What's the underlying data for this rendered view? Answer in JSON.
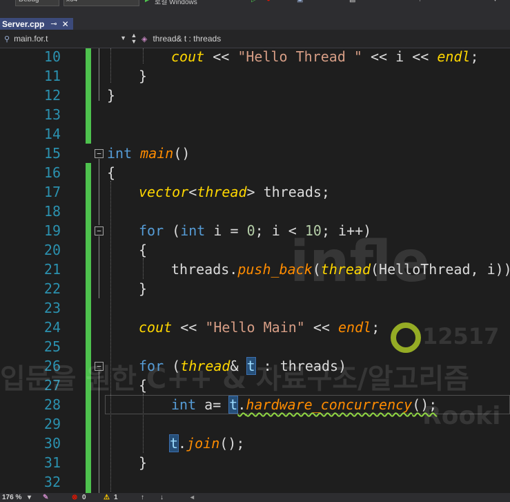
{
  "toolbar": {
    "config": "Debug",
    "platform": "x64",
    "run_label": "로컬 Windows"
  },
  "tab": {
    "filename": "Server.cpp",
    "pin_icon": "pin-icon",
    "close_icon": "close-icon"
  },
  "navbar": {
    "scope": "main.for.t",
    "member": "thread& t : threads"
  },
  "editor": {
    "line_numbers": [
      "10",
      "11",
      "12",
      "13",
      "14",
      "15",
      "16",
      "17",
      "18",
      "19",
      "20",
      "21",
      "22",
      "23",
      "24",
      "25",
      "26",
      "27",
      "28",
      "29",
      "30",
      "31",
      "32"
    ],
    "code": {
      "l10": {
        "a": "cout",
        "b": " << ",
        "c": "\"Hello Thread \"",
        "d": " << i << ",
        "e": "endl",
        "f": ";"
      },
      "l11": "}",
      "l12": "}",
      "l15": {
        "a": "int",
        "b": " ",
        "c": "main",
        "d": "()"
      },
      "l16": "{",
      "l17": {
        "a": "vector",
        "b": "<",
        "c": "thread",
        "d": ">",
        "e": " threads;"
      },
      "l19": {
        "a": "for",
        "b": " (",
        "c": "int",
        "d": " i = ",
        "e": "0",
        "f": "; i < ",
        "g": "10",
        "h": "; i++)"
      },
      "l20": "{",
      "l21": {
        "a": "threads.",
        "b": "push_back",
        "c": "(",
        "d": "thread",
        "e": "(HelloThread, i));"
      },
      "l22": "}",
      "l24": {
        "a": "cout",
        "b": " << ",
        "c": "\"Hello Main\"",
        "d": " << ",
        "e": "endl",
        "f": ";"
      },
      "l26": {
        "a": "for",
        "b": " (",
        "c": "thread",
        "d": "& ",
        "e": "t",
        "f": " : threads)"
      },
      "l27": "{",
      "l28": {
        "a": "int",
        "b": " a= ",
        "c": "t",
        "d": ".",
        "e": "hardware_concurrency",
        "f": "();"
      },
      "l30": {
        "a": "t",
        "b": ".",
        "c": "join",
        "d": "();"
      },
      "l31": "}"
    }
  },
  "watermark": {
    "text_line1": "입문을 원한 C++ & 자료구조/알고리즘",
    "text_line2": "Rooki",
    "logo_text": "infle",
    "number": "12517"
  },
  "statusbar": {
    "zoom": "176 %",
    "errors": "0",
    "warnings": "1"
  }
}
